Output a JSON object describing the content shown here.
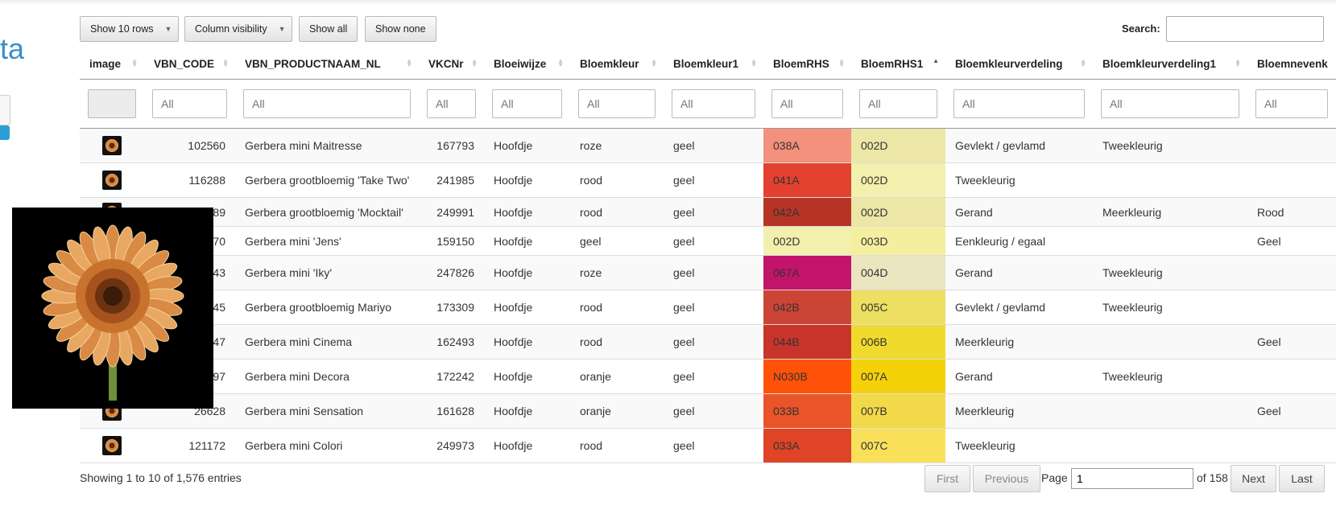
{
  "sidebar_fragment": {
    "title": "ta"
  },
  "toolbar": {
    "rows_label": "Show 10 rows",
    "colvis_label": "Column visibility",
    "show_all": "Show all",
    "show_none": "Show none",
    "search_label": "Search:",
    "search_value": ""
  },
  "columns": [
    {
      "key": "image",
      "label": "image"
    },
    {
      "key": "code",
      "label": "VBN_CODE"
    },
    {
      "key": "name",
      "label": "VBN_PRODUCTNAAM_NL"
    },
    {
      "key": "vkc",
      "label": "VKCNr"
    },
    {
      "key": "bloeiwijze",
      "label": "Bloeiwijze"
    },
    {
      "key": "kleur",
      "label": "Bloemkleur"
    },
    {
      "key": "kleur1",
      "label": "Bloemkleur1"
    },
    {
      "key": "rhs",
      "label": "BloemRHS"
    },
    {
      "key": "rhs1",
      "label": "BloemRHS1"
    },
    {
      "key": "verdeling",
      "label": "Bloemkleurverdeling"
    },
    {
      "key": "verdeling1",
      "label": "Bloemkleurverdeling1"
    },
    {
      "key": "neven",
      "label": "Bloemnevenk"
    }
  ],
  "filter_placeholder": "All",
  "rows": [
    {
      "code": "102560",
      "name": "Gerbera mini Maitresse",
      "vkc": "167793",
      "bloeiwijze": "Hoofdje",
      "kleur": "roze",
      "kleur1": "geel",
      "rhs": "038A",
      "rhs_color": "#f3917d",
      "rhs1": "002D",
      "rhs1_color": "#ece7a6",
      "verdeling": "Gevlekt / gevlamd",
      "verdeling1": "Tweekleurig",
      "neven": ""
    },
    {
      "code": "116288",
      "name": "Gerbera grootbloemig 'Take Two'",
      "vkc": "241985",
      "bloeiwijze": "Hoofdje",
      "kleur": "rood",
      "kleur1": "geel",
      "rhs": "041A",
      "rhs_color": "#e2412f",
      "rhs1": "002D",
      "rhs1_color": "#f3efac",
      "verdeling": "Tweekleurig",
      "verdeling1": "",
      "neven": ""
    },
    {
      "code": "124189",
      "name": "Gerbera grootbloemig 'Mocktail'",
      "vkc": "249991",
      "bloeiwijze": "Hoofdje",
      "kleur": "rood",
      "kleur1": "geel",
      "rhs": "042A",
      "rhs_color": "#b53425",
      "rhs1": "002D",
      "rhs1_color": "#ece7a6",
      "verdeling": "Gerand",
      "verdeling1": "Meerkleurig",
      "neven": "Rood"
    },
    {
      "code": "102470",
      "name": "Gerbera mini 'Jens'",
      "vkc": "159150",
      "bloeiwijze": "Hoofdje",
      "kleur": "geel",
      "kleur1": "geel",
      "rhs": "002D",
      "rhs_color": "#f3efac",
      "rhs1": "003D",
      "rhs1_color": "#f3ef9f",
      "verdeling": "Eenkleurig / egaal",
      "verdeling1": "",
      "neven": "Geel"
    },
    {
      "code": "124643",
      "name": "Gerbera mini 'Iky'",
      "vkc": "247826",
      "bloeiwijze": "Hoofdje",
      "kleur": "roze",
      "kleur1": "geel",
      "rhs": "067A",
      "rhs_color": "#c2146a",
      "rhs1": "004D",
      "rhs1_color": "#ebe5c0",
      "verdeling": "Gerand",
      "verdeling1": "Tweekleurig",
      "neven": ""
    },
    {
      "code": "110845",
      "name": "Gerbera grootbloemig Mariyo",
      "vkc": "173309",
      "bloeiwijze": "Hoofdje",
      "kleur": "rood",
      "kleur1": "geel",
      "rhs": "042B",
      "rhs_color": "#cc4436",
      "rhs1": "005C",
      "rhs1_color": "#ecdf62",
      "verdeling": "Gevlekt / gevlamd",
      "verdeling1": "Tweekleurig",
      "neven": ""
    },
    {
      "code": "103847",
      "name": "Gerbera mini Cinema",
      "vkc": "162493",
      "bloeiwijze": "Hoofdje",
      "kleur": "rood",
      "kleur1": "geel",
      "rhs": "044B",
      "rhs_color": "#c8342a",
      "rhs1": "006B",
      "rhs1_color": "#f1da2e",
      "verdeling": "Meerkleurig",
      "verdeling1": "",
      "neven": "Geel"
    },
    {
      "code": "107997",
      "name": "Gerbera mini Decora",
      "vkc": "172242",
      "bloeiwijze": "Hoofdje",
      "kleur": "oranje",
      "kleur1": "geel",
      "rhs": "N030B",
      "rhs_color": "#ff5208",
      "rhs1": "007A",
      "rhs1_color": "#f5d10a",
      "verdeling": "Gerand",
      "verdeling1": "Tweekleurig",
      "neven": ""
    },
    {
      "code": "26628",
      "name": "Gerbera mini Sensation",
      "vkc": "161628",
      "bloeiwijze": "Hoofdje",
      "kleur": "oranje",
      "kleur1": "geel",
      "rhs": "033B",
      "rhs_color": "#e95529",
      "rhs1": "007B",
      "rhs1_color": "#f2d94a",
      "verdeling": "Meerkleurig",
      "verdeling1": "",
      "neven": "Geel"
    },
    {
      "code": "121172",
      "name": "Gerbera mini Colori",
      "vkc": "249973",
      "bloeiwijze": "Hoofdje",
      "kleur": "rood",
      "kleur1": "geel",
      "rhs": "033A",
      "rhs_color": "#df4427",
      "rhs1": "007C",
      "rhs1_color": "#f8e05a",
      "verdeling": "Tweekleurig",
      "verdeling1": "",
      "neven": ""
    }
  ],
  "footer": {
    "info": "Showing 1 to 10 of 1,576 entries",
    "first": "First",
    "previous": "Previous",
    "page_label": "Page",
    "page_value": "1",
    "of_label": "of 158",
    "next": "Next",
    "last": "Last"
  },
  "colors": {
    "link_blue": "#3a8fc7"
  },
  "icons": {
    "preview": "gerbera-flower-image",
    "thumbs": "flower-thumbnail-icon"
  }
}
